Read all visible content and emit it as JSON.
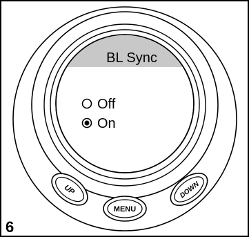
{
  "figure_number": "6",
  "screen": {
    "title": "BL Sync",
    "title_bar_color": "#c8c8c8",
    "options": [
      {
        "label": "Off",
        "selected": false
      },
      {
        "label": "On",
        "selected": true
      }
    ]
  },
  "buttons": {
    "up_label": "UP",
    "menu_label": "MENU",
    "down_label": "DOWN"
  }
}
